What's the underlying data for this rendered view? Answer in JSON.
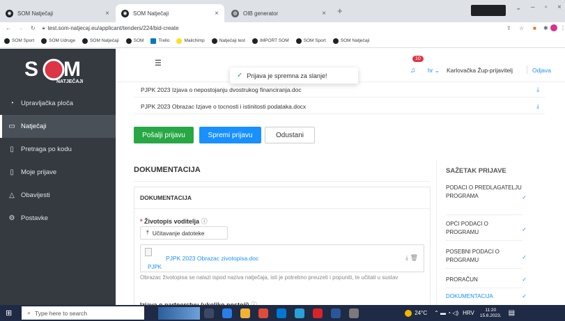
{
  "browser": {
    "tabs": [
      {
        "title": "SOM Natječaji",
        "close": "×"
      },
      {
        "title": "SOM Natječaji",
        "close": "×"
      },
      {
        "title": "OIB generator",
        "close": "×"
      }
    ],
    "new_tab": "+",
    "address": "test.som-natjecaj.eu/applicant/tenders/224/bid-create",
    "bookmarks": [
      "SOM Sport",
      "SOM Udruge",
      "SOM Natječaji",
      "SOM",
      "Trello",
      "Mailchimp",
      "Natječaji test",
      "IMPORT SOM",
      "SOM Sport",
      "SOM Natječaji"
    ]
  },
  "sidebar": {
    "logo_text": "NATJEČAJI",
    "items": [
      {
        "label": "Upravljačka ploča",
        "icon": "dashboard-icon"
      },
      {
        "label": "Natječaji",
        "icon": "folder-icon"
      },
      {
        "label": "Pretraga po kodu",
        "icon": "document-icon"
      },
      {
        "label": "Moje prijave",
        "icon": "document-icon"
      },
      {
        "label": "Obavijesti",
        "icon": "bell-icon"
      },
      {
        "label": "Postavke",
        "icon": "gear-icon"
      }
    ]
  },
  "header": {
    "notif_count": "10",
    "lang": "hr",
    "user": "Karlovačka Žup-prijavitelj",
    "logout": "Odjava"
  },
  "toast": {
    "message": "Prijava je spremna za slanje!"
  },
  "files": [
    "PJPK 2023 Izjava o nepostojanju dvostrukog financiranja.doc",
    "PJPK 2023 Obrazac Izjave o tocnosti i istinitosti podataka.docx"
  ],
  "actions": {
    "send": "Pošalji prijavu",
    "save": "Spremi prijavu",
    "cancel": "Odustani"
  },
  "documentation": {
    "heading": "DOKUMENTACIJA",
    "panel_title": "DOKUMENTACIJA",
    "required_mark": "*",
    "field_label": "Životopis voditelja",
    "upload_label": "Učitavanje datoteke",
    "uploaded_file": "PJPK 2023 Obrazac zivotopisa.doc",
    "uploaded_tag": "PJPK",
    "help_text": "Obrazac životopisa se nalazi ispod naziva natječaja, isti je potrebno preuzeti i popuniti, te učitati u sustav",
    "next_field": "Izjava o partnerstvu (ukoliko postoji)"
  },
  "summary": {
    "title": "SAŽETAK PRIJAVE",
    "items": [
      "PODACI O PREDLAGATELJU PROGRAMA",
      "OPĆI PODACI O PROGRAMU",
      "POSEBNI PODACI O PROGRAMU",
      "PRORAČUN",
      "DOKUMENTACIJA"
    ]
  },
  "taskbar": {
    "search": "Type here to search",
    "weather": "24°C",
    "lang": "HRV",
    "time": "11:20",
    "date": "15.6.2023."
  },
  "colors": {
    "sidebar": "#343a40",
    "primary": "#1890ff",
    "success": "#28a745",
    "danger": "#dc3545"
  }
}
